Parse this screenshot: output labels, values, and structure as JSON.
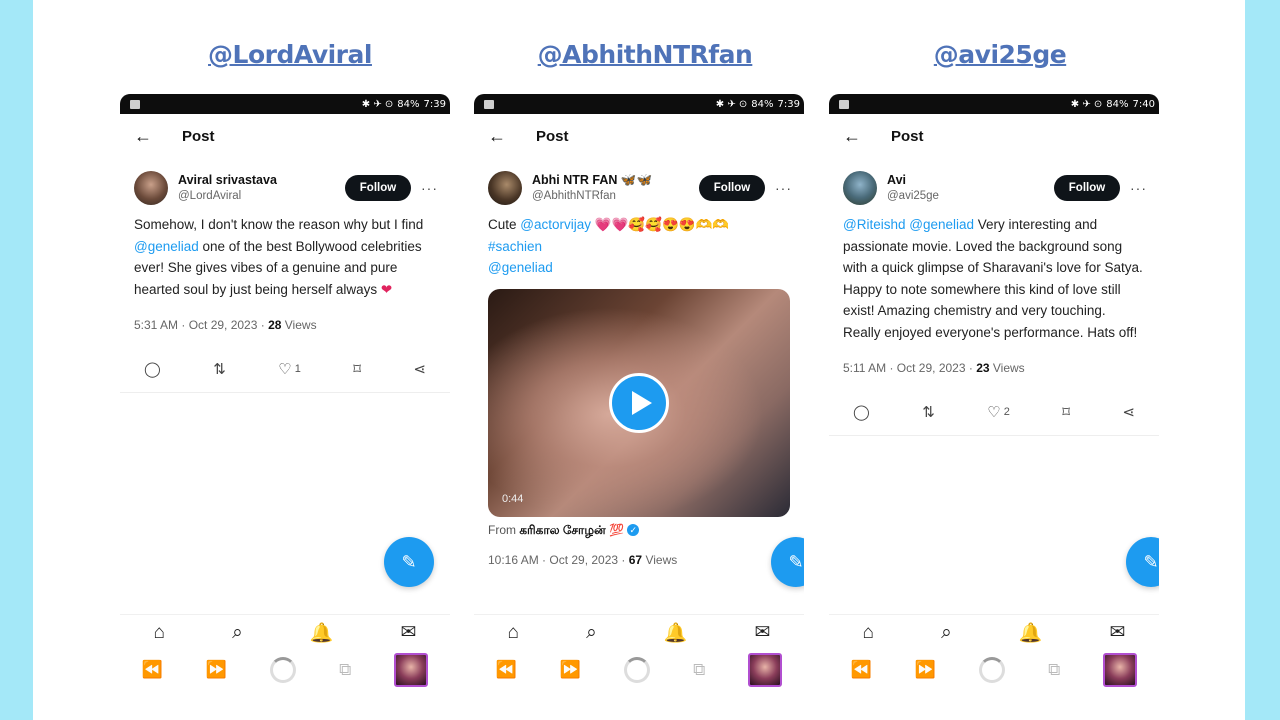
{
  "colors": {
    "side_background": "#a4e8f8",
    "link": "#1d9bf0",
    "handle": "#4f73b8",
    "follow_bg": "#0f1419"
  },
  "phones": [
    {
      "handle": "@LordAviral",
      "status": {
        "icons": "✱ ✈ ⊙",
        "battery": "84%",
        "time": "7:39"
      },
      "top_title": "Post",
      "author": {
        "name": "Aviral srivastava",
        "username": "@LordAviral"
      },
      "follow_label": "Follow",
      "tweet": {
        "t1": "Somehow, I don't know the reason why but I find ",
        "m1": "@geneliad",
        "t2": " one of the best Bollywood celebrities ever! She gives vibes of a genuine and pure hearted soul by just being herself always ",
        "emoji": "❤"
      },
      "meta": {
        "datetime": "5:31 AM · Oct 29, 2023 · ",
        "views_count": "28",
        "views_label": " Views"
      },
      "likes": "1"
    },
    {
      "handle": "@AbhithNTRfan",
      "status": {
        "icons": "✱ ✈ ⊙",
        "battery": "84%",
        "time": "7:39"
      },
      "top_title": "Post",
      "author": {
        "name": "Abhi NTR FAN 🦋🦋",
        "username": "@AbhithNTRfan"
      },
      "follow_label": "Follow",
      "tweet": {
        "t1": "Cute ",
        "m1": "@actorvijay",
        "emoji": " 💗💗🥰🥰😍😍🫶🫶",
        "m2": "#sachien",
        "m3": "@geneliad"
      },
      "video": {
        "duration": "0:44"
      },
      "from": {
        "prefix": "From ",
        "source": "கரிகால சோழன் 💯"
      },
      "meta": {
        "datetime": "10:16 AM · Oct 29, 2023 · ",
        "views_count": "67",
        "views_label": " Views"
      }
    },
    {
      "handle": "@avi25ge",
      "status": {
        "icons": "✱ ✈ ⊙",
        "battery": "84%",
        "time": "7:40"
      },
      "top_title": "Post",
      "author": {
        "name": "Avi",
        "username": "@avi25ge"
      },
      "follow_label": "Follow",
      "tweet": {
        "m1": "@Riteishd",
        "m2": "@geneliad",
        "t1": " Very interesting and passionate movie. Loved the background song with a quick glimpse of Sharavani's love for Satya. Happy to note somewhere this kind of love still exist! Amazing chemistry and very touching. Really enjoyed everyone's performance. Hats off!"
      },
      "meta": {
        "datetime": "5:11 AM · Oct 29, 2023 · ",
        "views_count": "23",
        "views_label": " Views"
      },
      "likes": "2"
    }
  ],
  "icons": {
    "back": "←",
    "more": "···",
    "reply": "◯",
    "retweet": "⇅",
    "like": "♡",
    "bookmark": "⌑",
    "share": "⋖",
    "fab": "✎",
    "home": "⌂",
    "search": "⌕",
    "bell": "🔔",
    "mail": "✉",
    "prev": "⏪",
    "next": "⏩",
    "tabs": "⧉"
  }
}
